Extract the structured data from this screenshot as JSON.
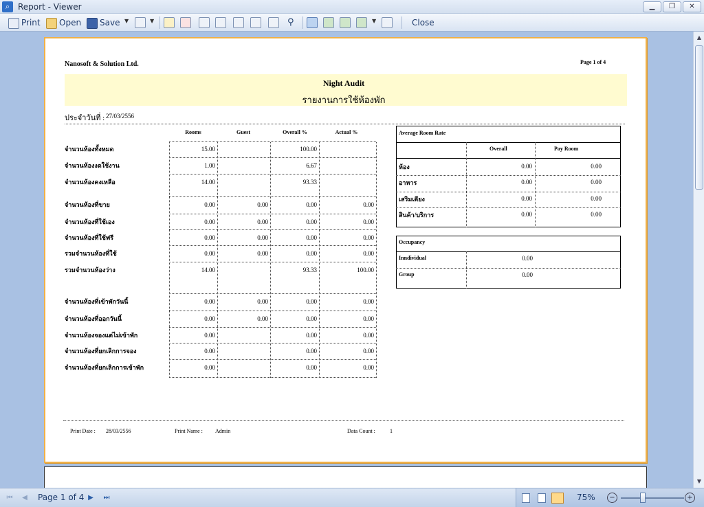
{
  "window": {
    "title": "Report - Viewer",
    "min_glyph": "▁",
    "max_glyph": "❐",
    "close_glyph": "✕"
  },
  "toolbar": {
    "print_label": "Print",
    "open_label": "Open",
    "save_label": "Save",
    "close_label": "Close"
  },
  "report": {
    "company": "Nanosoft & Solution Ltd.",
    "page_label": "Page 1 of 4",
    "title_en": "Night Audit",
    "title_th": "รายงานการใช้ห้องพัก",
    "date_label": "ประจำวันที่ :",
    "date_value": "27/03/2556",
    "columns": [
      "Rooms",
      "Guest",
      "Overall %",
      "Actual %"
    ],
    "rows": [
      {
        "label": "จำนวนห้องทั้งหมด",
        "rooms": "15.00",
        "guest": "",
        "overall": "100.00",
        "actual": ""
      },
      {
        "label": "จำนวนห้องงดใช้งาน",
        "rooms": "1.00",
        "guest": "",
        "overall": "6.67",
        "actual": ""
      },
      {
        "label": "จำนวนห้องคงเหลือ",
        "rooms": "14.00",
        "guest": "",
        "overall": "93.33",
        "actual": ""
      },
      {
        "label": "จำนวนห้องที่ขาย",
        "rooms": "0.00",
        "guest": "0.00",
        "overall": "0.00",
        "actual": "0.00"
      },
      {
        "label": "จำนวนห้องที่ใช้เอง",
        "rooms": "0.00",
        "guest": "0.00",
        "overall": "0.00",
        "actual": "0.00"
      },
      {
        "label": "จำนวนห้องที่ใช้ฟรี",
        "rooms": "0.00",
        "guest": "0.00",
        "overall": "0.00",
        "actual": "0.00"
      },
      {
        "label": "รวมจำนวนห้องที่ใช้",
        "rooms": "0.00",
        "guest": "0.00",
        "overall": "0.00",
        "actual": "0.00"
      },
      {
        "label": "รวมจำนวนห้องว่าง",
        "rooms": "14.00",
        "guest": "",
        "overall": "93.33",
        "actual": "100.00"
      },
      {
        "label": "จำนวนห้องที่เข้าพักวันนี้",
        "rooms": "0.00",
        "guest": "0.00",
        "overall": "0.00",
        "actual": "0.00"
      },
      {
        "label": "จำนวนห้องที่ออกวันนี้",
        "rooms": "0.00",
        "guest": "0.00",
        "overall": "0.00",
        "actual": "0.00"
      },
      {
        "label": "จำนวนห้องจองแต่ไม่เข้าพัก",
        "rooms": "0.00",
        "guest": "",
        "overall": "0.00",
        "actual": "0.00"
      },
      {
        "label": "จำนวนห้องที่ยกเลิกการจอง",
        "rooms": "0.00",
        "guest": "",
        "overall": "0.00",
        "actual": "0.00"
      },
      {
        "label": "จำนวนห้องที่ยกเลิกการเข้าพัก",
        "rooms": "0.00",
        "guest": "",
        "overall": "0.00",
        "actual": "0.00"
      }
    ],
    "arr": {
      "title": "Average Room Rate",
      "col_overall": "Overall",
      "col_payroom": "Pay Room",
      "rows": [
        {
          "label": "ห้อง",
          "overall": "0.00",
          "payroom": "0.00"
        },
        {
          "label": "อาหาร",
          "overall": "0.00",
          "payroom": "0.00"
        },
        {
          "label": "เสริมเตียง",
          "overall": "0.00",
          "payroom": "0.00"
        },
        {
          "label": "สินค้า/บริการ",
          "overall": "0.00",
          "payroom": "0.00"
        }
      ]
    },
    "occupancy": {
      "title": "Occupancy",
      "rows": [
        {
          "label": "Inndividual",
          "value": "0.00"
        },
        {
          "label": "Group",
          "value": "0.00"
        }
      ]
    },
    "footer": {
      "print_date_label": "Print Date :",
      "print_date_value": "28/03/2556",
      "print_name_label": "Print Name :",
      "print_name_value": "Admin",
      "data_count_label": "Data Count :",
      "data_count_value": "1"
    }
  },
  "statusbar": {
    "page_text": "Page 1 of 4",
    "zoom": "75%"
  }
}
